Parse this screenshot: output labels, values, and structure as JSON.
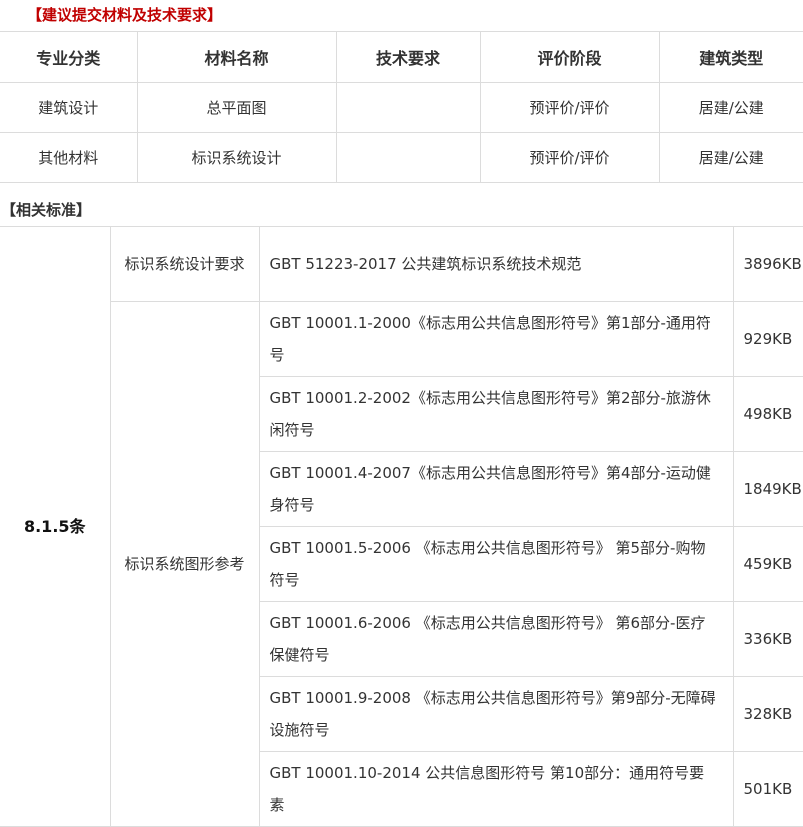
{
  "section1": {
    "title": "【建议提交材料及技术要求】",
    "headers": [
      "专业分类",
      "材料名称",
      "技术要求",
      "评价阶段",
      "建筑类型"
    ],
    "rows": [
      [
        "建筑设计",
        "总平面图",
        "",
        "预评价/评价",
        "居建/公建"
      ],
      [
        "其他材料",
        "标识系统设计",
        "",
        "预评价/评价",
        "居建/公建"
      ]
    ]
  },
  "section2": {
    "title": "【相关标准】",
    "clause": "8.1.5条",
    "groups": [
      {
        "category": "标识系统设计要求",
        "items": [
          {
            "name": "GBT 51223-2017 公共建筑标识系统技术规范",
            "size": "3896KB"
          }
        ]
      },
      {
        "category": "标识系统图形参考",
        "items": [
          {
            "name": "GBT 10001.1-2000《标志用公共信息图形符号》第1部分-通用符号",
            "size": "929KB"
          },
          {
            "name": "GBT 10001.2-2002《标志用公共信息图形符号》第2部分-旅游休闲符号",
            "size": "498KB"
          },
          {
            "name": "GBT 10001.4-2007《标志用公共信息图形符号》第4部分-运动健身符号",
            "size": "1849KB"
          },
          {
            "name": "GBT 10001.5-2006 《标志用公共信息图形符号》 第5部分-购物符号",
            "size": "459KB"
          },
          {
            "name": "GBT 10001.6-2006 《标志用公共信息图形符号》 第6部分-医疗保健符号",
            "size": "336KB"
          },
          {
            "name": "GBT 10001.9-2008 《标志用公共信息图形符号》第9部分-无障碍设施符号",
            "size": "328KB"
          },
          {
            "name": "GBT 10001.10-2014 公共信息图形符号 第10部分：通用符号要素",
            "size": "501KB"
          }
        ]
      }
    ]
  }
}
